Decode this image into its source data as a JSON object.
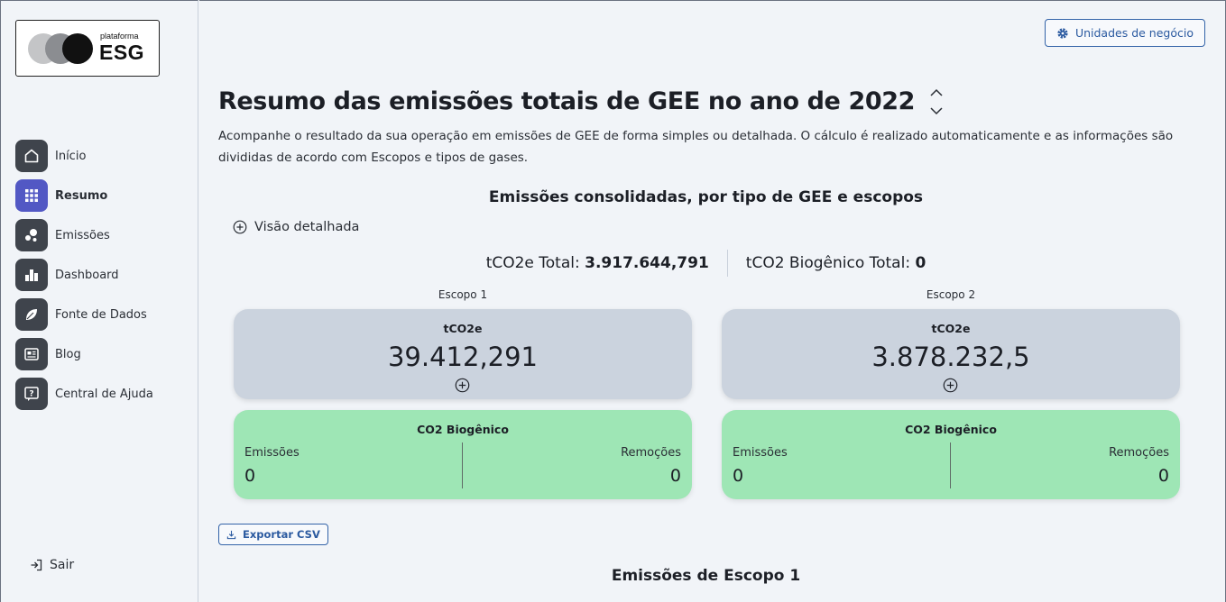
{
  "brand": {
    "top_word": "plataforma",
    "main_word": "ESG"
  },
  "sidebar": {
    "items": [
      {
        "label": "Início",
        "icon": "home-icon"
      },
      {
        "label": "Resumo",
        "icon": "grid-icon",
        "active": true
      },
      {
        "label": "Emissões",
        "icon": "bubbles-icon"
      },
      {
        "label": "Dashboard",
        "icon": "bar-chart-icon"
      },
      {
        "label": "Fonte de Dados",
        "icon": "leaf-icon"
      },
      {
        "label": "Blog",
        "icon": "newspaper-icon"
      },
      {
        "label": "Central de Ajuda",
        "icon": "help-icon"
      }
    ],
    "logout_label": "Sair"
  },
  "header": {
    "business_units_label": "Unidades de negócio"
  },
  "page": {
    "title": "Resumo das emissões totais de GEE no ano de 2022",
    "description": "Acompanhe o resultado da sua operação em emissões de GEE de forma simples ou detalhada. O cálculo é realizado automaticamente e as informações são divididas de acordo com Escopos e tipos de gases.",
    "section_title": "Emissões consolidadas, por tipo de GEE e escopos",
    "detail_toggle_label": "Visão detalhada",
    "totals": {
      "tco2e_label": "tCO2e Total:",
      "tco2e_value": "3.917.644,791",
      "biogenic_label": "tCO2 Biogênico Total:",
      "biogenic_value": "0"
    },
    "scopes": [
      {
        "label": "Escopo 1",
        "unit": "tCO2e",
        "value": "39.412,291",
        "biogenic": {
          "title": "CO2 Biogênico",
          "emissions_label": "Emissões",
          "emissions_value": "0",
          "removals_label": "Remoções",
          "removals_value": "0"
        }
      },
      {
        "label": "Escopo 2",
        "unit": "tCO2e",
        "value": "3.878.232,5",
        "biogenic": {
          "title": "CO2 Biogênico",
          "emissions_label": "Emissões",
          "emissions_value": "0",
          "removals_label": "Remoções",
          "removals_value": "0"
        }
      }
    ],
    "export_label": "Exportar CSV",
    "next_section_title": "Emissões de Escopo 1"
  },
  "colors": {
    "accent": "#5258c4",
    "nav_icon_bg": "#3f444c",
    "card_grey": "#cbd3de",
    "card_green": "#9ee6b5",
    "button_blue": "#2b5aa0"
  }
}
